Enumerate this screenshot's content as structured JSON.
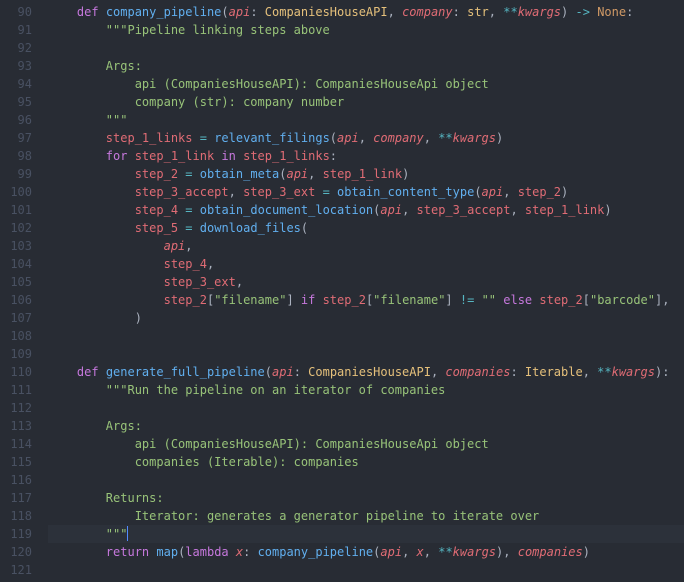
{
  "lines": [
    {
      "n": 90,
      "indent": 1,
      "tokens": [
        [
          "kw",
          "def "
        ],
        [
          "fn",
          "company_pipeline"
        ],
        [
          "pun",
          "("
        ],
        [
          "prm",
          "api"
        ],
        [
          "pun",
          ": "
        ],
        [
          "cls",
          "CompaniesHouseAPI"
        ],
        [
          "pun",
          ", "
        ],
        [
          "prm",
          "company"
        ],
        [
          "pun",
          ": "
        ],
        [
          "cls",
          "str"
        ],
        [
          "pun",
          ", "
        ],
        [
          "op",
          "**"
        ],
        [
          "prm",
          "kwargs"
        ],
        [
          "pun",
          ") "
        ],
        [
          "op",
          "->"
        ],
        [
          "pun",
          " "
        ],
        [
          "self",
          "None"
        ],
        [
          "pun",
          ":"
        ]
      ]
    },
    {
      "n": 91,
      "indent": 2,
      "tokens": [
        [
          "str",
          "\"\"\"Pipeline linking steps above"
        ]
      ]
    },
    {
      "n": 92,
      "indent": 0,
      "tokens": []
    },
    {
      "n": 93,
      "indent": 2,
      "tokens": [
        [
          "str",
          "Args:"
        ]
      ]
    },
    {
      "n": 94,
      "indent": 3,
      "tokens": [
        [
          "str",
          "api (CompaniesHouseAPI): CompaniesHouseApi object"
        ]
      ]
    },
    {
      "n": 95,
      "indent": 3,
      "tokens": [
        [
          "str",
          "company (str): company number"
        ]
      ]
    },
    {
      "n": 96,
      "indent": 2,
      "tokens": [
        [
          "str",
          "\"\"\""
        ]
      ]
    },
    {
      "n": 97,
      "indent": 2,
      "tokens": [
        [
          "var",
          "step_1_links"
        ],
        [
          "pun",
          " "
        ],
        [
          "op",
          "="
        ],
        [
          "pun",
          " "
        ],
        [
          "fn",
          "relevant_filings"
        ],
        [
          "pun",
          "("
        ],
        [
          "prm",
          "api"
        ],
        [
          "pun",
          ", "
        ],
        [
          "prm",
          "company"
        ],
        [
          "pun",
          ", "
        ],
        [
          "op",
          "**"
        ],
        [
          "prm",
          "kwargs"
        ],
        [
          "pun",
          ")"
        ]
      ]
    },
    {
      "n": 98,
      "indent": 2,
      "tokens": [
        [
          "kw",
          "for "
        ],
        [
          "var",
          "step_1_link"
        ],
        [
          "kw",
          " in "
        ],
        [
          "var",
          "step_1_links"
        ],
        [
          "pun",
          ":"
        ]
      ]
    },
    {
      "n": 99,
      "indent": 3,
      "tokens": [
        [
          "var",
          "step_2"
        ],
        [
          "pun",
          " "
        ],
        [
          "op",
          "="
        ],
        [
          "pun",
          " "
        ],
        [
          "fn",
          "obtain_meta"
        ],
        [
          "pun",
          "("
        ],
        [
          "prm",
          "api"
        ],
        [
          "pun",
          ", "
        ],
        [
          "var",
          "step_1_link"
        ],
        [
          "pun",
          ")"
        ]
      ]
    },
    {
      "n": 100,
      "indent": 3,
      "tokens": [
        [
          "var",
          "step_3_accept"
        ],
        [
          "pun",
          ", "
        ],
        [
          "var",
          "step_3_ext"
        ],
        [
          "pun",
          " "
        ],
        [
          "op",
          "="
        ],
        [
          "pun",
          " "
        ],
        [
          "fn",
          "obtain_content_type"
        ],
        [
          "pun",
          "("
        ],
        [
          "prm",
          "api"
        ],
        [
          "pun",
          ", "
        ],
        [
          "var",
          "step_2"
        ],
        [
          "pun",
          ")"
        ]
      ]
    },
    {
      "n": 101,
      "indent": 3,
      "tokens": [
        [
          "var",
          "step_4"
        ],
        [
          "pun",
          " "
        ],
        [
          "op",
          "="
        ],
        [
          "pun",
          " "
        ],
        [
          "fn",
          "obtain_document_location"
        ],
        [
          "pun",
          "("
        ],
        [
          "prm",
          "api"
        ],
        [
          "pun",
          ", "
        ],
        [
          "var",
          "step_3_accept"
        ],
        [
          "pun",
          ", "
        ],
        [
          "var",
          "step_1_link"
        ],
        [
          "pun",
          ")"
        ]
      ]
    },
    {
      "n": 102,
      "indent": 3,
      "tokens": [
        [
          "var",
          "step_5"
        ],
        [
          "pun",
          " "
        ],
        [
          "op",
          "="
        ],
        [
          "pun",
          " "
        ],
        [
          "fn",
          "download_files"
        ],
        [
          "pun",
          "("
        ]
      ]
    },
    {
      "n": 103,
      "indent": 4,
      "tokens": [
        [
          "prm",
          "api"
        ],
        [
          "pun",
          ","
        ]
      ]
    },
    {
      "n": 104,
      "indent": 4,
      "tokens": [
        [
          "var",
          "step_4"
        ],
        [
          "pun",
          ","
        ]
      ]
    },
    {
      "n": 105,
      "indent": 4,
      "tokens": [
        [
          "var",
          "step_3_ext"
        ],
        [
          "pun",
          ","
        ]
      ]
    },
    {
      "n": 106,
      "indent": 4,
      "tokens": [
        [
          "var",
          "step_2"
        ],
        [
          "pun",
          "["
        ],
        [
          "str",
          "\"filename\""
        ],
        [
          "pun",
          "] "
        ],
        [
          "kw",
          "if "
        ],
        [
          "var",
          "step_2"
        ],
        [
          "pun",
          "["
        ],
        [
          "str",
          "\"filename\""
        ],
        [
          "pun",
          "] "
        ],
        [
          "op",
          "!="
        ],
        [
          "pun",
          " "
        ],
        [
          "str",
          "\"\""
        ],
        [
          "pun",
          " "
        ],
        [
          "kw",
          "else "
        ],
        [
          "var",
          "step_2"
        ],
        [
          "pun",
          "["
        ],
        [
          "str",
          "\"barcode\""
        ],
        [
          "pun",
          "],"
        ]
      ]
    },
    {
      "n": 107,
      "indent": 3,
      "tokens": [
        [
          "pun",
          ")"
        ]
      ]
    },
    {
      "n": 108,
      "indent": 0,
      "tokens": []
    },
    {
      "n": 109,
      "indent": 0,
      "tokens": []
    },
    {
      "n": 110,
      "indent": 1,
      "tokens": [
        [
          "kw",
          "def "
        ],
        [
          "fn",
          "generate_full_pipeline"
        ],
        [
          "pun",
          "("
        ],
        [
          "prm",
          "api"
        ],
        [
          "pun",
          ": "
        ],
        [
          "cls",
          "CompaniesHouseAPI"
        ],
        [
          "pun",
          ", "
        ],
        [
          "prm",
          "companies"
        ],
        [
          "pun",
          ": "
        ],
        [
          "cls",
          "Iterable"
        ],
        [
          "pun",
          ", "
        ],
        [
          "op",
          "**"
        ],
        [
          "prm",
          "kwargs"
        ],
        [
          "pun",
          "):"
        ]
      ]
    },
    {
      "n": 111,
      "indent": 2,
      "tokens": [
        [
          "str",
          "\"\"\"Run the pipeline on an iterator of companies"
        ]
      ]
    },
    {
      "n": 112,
      "indent": 0,
      "tokens": []
    },
    {
      "n": 113,
      "indent": 2,
      "tokens": [
        [
          "str",
          "Args:"
        ]
      ]
    },
    {
      "n": 114,
      "indent": 3,
      "tokens": [
        [
          "str",
          "api (CompaniesHouseAPI): CompaniesHouseApi object"
        ]
      ]
    },
    {
      "n": 115,
      "indent": 3,
      "tokens": [
        [
          "str",
          "companies (Iterable): companies"
        ]
      ]
    },
    {
      "n": 116,
      "indent": 0,
      "tokens": []
    },
    {
      "n": 117,
      "indent": 2,
      "tokens": [
        [
          "str",
          "Returns:"
        ]
      ]
    },
    {
      "n": 118,
      "indent": 3,
      "tokens": [
        [
          "str",
          "Iterator: generates a generator pipeline to iterate over"
        ]
      ]
    },
    {
      "n": 119,
      "indent": 2,
      "hl": true,
      "cursor": true,
      "tokens": [
        [
          "str",
          "\"\"\""
        ]
      ]
    },
    {
      "n": 120,
      "indent": 2,
      "tokens": [
        [
          "kw",
          "return "
        ],
        [
          "fn",
          "map"
        ],
        [
          "pun",
          "("
        ],
        [
          "kw",
          "lambda "
        ],
        [
          "prm",
          "x"
        ],
        [
          "pun",
          ": "
        ],
        [
          "fn",
          "company_pipeline"
        ],
        [
          "pun",
          "("
        ],
        [
          "prm",
          "api"
        ],
        [
          "pun",
          ", "
        ],
        [
          "prm",
          "x"
        ],
        [
          "pun",
          ", "
        ],
        [
          "op",
          "**"
        ],
        [
          "prm",
          "kwargs"
        ],
        [
          "pun",
          "), "
        ],
        [
          "prm",
          "companies"
        ],
        [
          "pun",
          ")"
        ]
      ]
    },
    {
      "n": 121,
      "indent": 0,
      "tokens": []
    }
  ],
  "indent_unit": "    "
}
